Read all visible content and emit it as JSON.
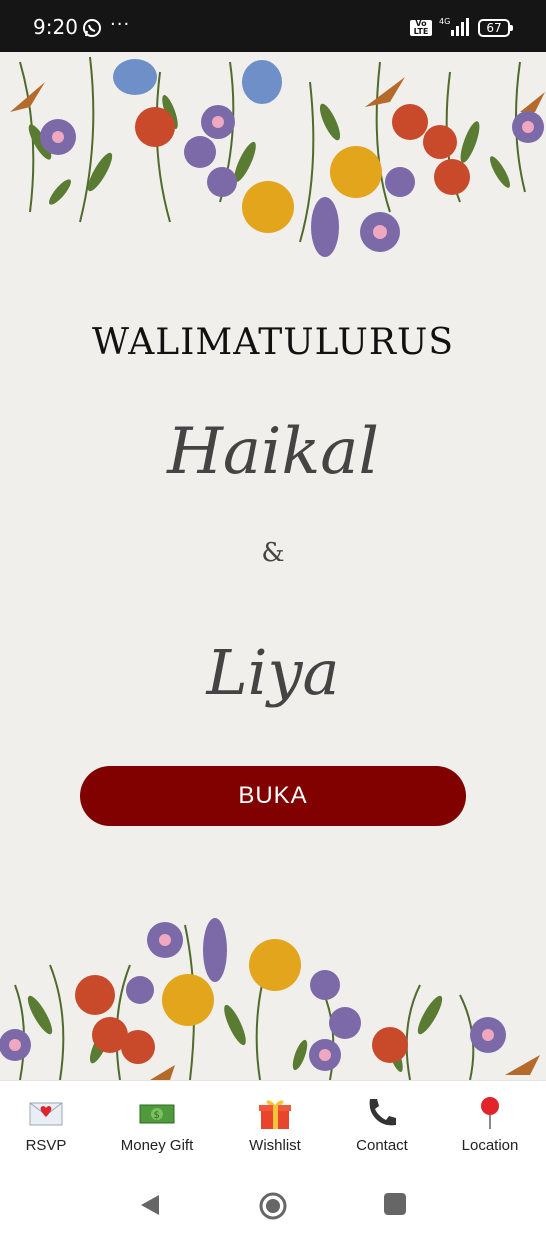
{
  "status_bar": {
    "time": "9:20",
    "more": "···",
    "network": "4G",
    "volte": "Vo LTE",
    "battery": "67"
  },
  "invitation": {
    "heading": "WALIMATULURUS",
    "name_1": "Haikal",
    "ampersand": "&",
    "name_2": "Liya",
    "open_button": "BUKA"
  },
  "bottom_nav": {
    "items": [
      {
        "label": "RSVP",
        "icon": "love-letter-icon"
      },
      {
        "label": "Money Gift",
        "icon": "money-icon"
      },
      {
        "label": "Wishlist",
        "icon": "gift-icon"
      },
      {
        "label": "Contact",
        "icon": "phone-icon"
      },
      {
        "label": "Location",
        "icon": "pin-icon"
      }
    ]
  },
  "colors": {
    "background": "#f0efec",
    "button": "#810000",
    "status_bar": "#151515"
  }
}
